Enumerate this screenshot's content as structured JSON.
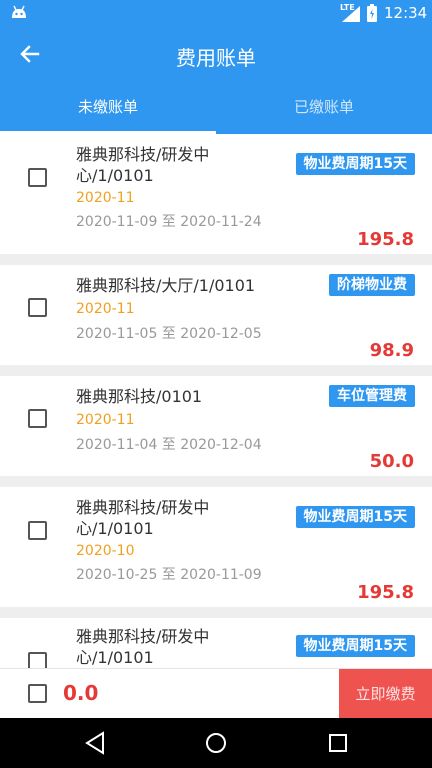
{
  "status_bar": {
    "network": "LTE",
    "time": "12:34",
    "icons": [
      "android-icon",
      "signal-icon",
      "battery-icon"
    ]
  },
  "app_bar": {
    "title": "费用账单",
    "back_icon": "arrow-left-icon"
  },
  "tabs": [
    {
      "label": "未缴账单",
      "active": true
    },
    {
      "label": "已缴账单",
      "active": false
    }
  ],
  "bills": [
    {
      "name": "雅典那科技/研发中心/1/0101",
      "period": "2020-11",
      "range": "2020-11-09 至 2020-11-24",
      "tag": "物业费周期15天",
      "amount": "195.8",
      "checked": false
    },
    {
      "name": "雅典那科技/大厅/1/0101",
      "period": "2020-11",
      "range": "2020-11-05 至 2020-12-05",
      "tag": "阶梯物业费",
      "amount": "98.9",
      "checked": false
    },
    {
      "name": "雅典那科技/0101",
      "period": "2020-11",
      "range": "2020-11-04 至 2020-12-04",
      "tag": "车位管理费",
      "amount": "50.0",
      "checked": false
    },
    {
      "name": "雅典那科技/研发中心/1/0101",
      "period": "2020-10",
      "range": "2020-10-25 至 2020-11-09",
      "tag": "物业费周期15天",
      "amount": "195.8",
      "checked": false
    },
    {
      "name": "雅典那科技/研发中心/1/0101",
      "period": "",
      "range": "",
      "tag": "物业费周期15天",
      "amount": "",
      "checked": false
    }
  ],
  "footer": {
    "total": "0.0",
    "pay_label": "立即缴费"
  },
  "colors": {
    "primary": "#2f97ef",
    "period": "#f0a020",
    "amount": "#e53935",
    "pay_button": "#ef5350"
  }
}
